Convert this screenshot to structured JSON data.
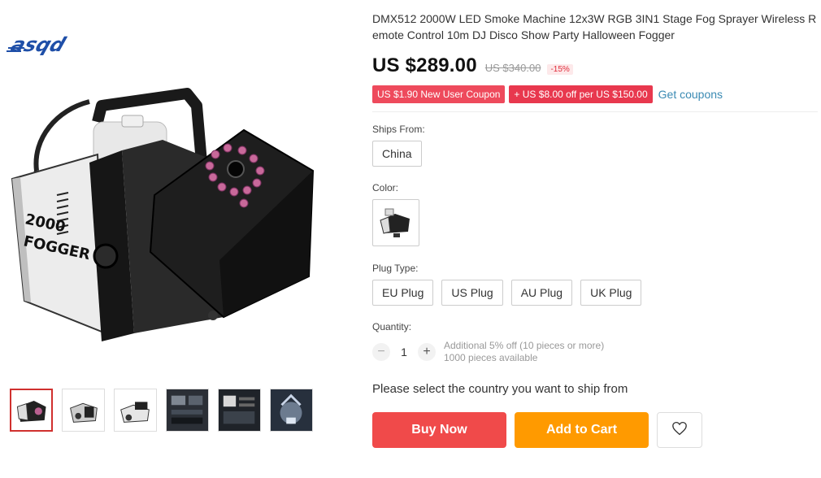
{
  "brand": {
    "logo_text": "asqd"
  },
  "product": {
    "title": "DMX512 2000W LED Smoke Machine 12x3W RGB 3IN1 Stage Fog Sprayer Wireless Remote Control 10m DJ Disco Show Party Halloween Fogger",
    "image_label": "2000 FOGGER"
  },
  "price": {
    "current": "US $289.00",
    "original": "US $340.00",
    "discount": "-15%"
  },
  "coupons": {
    "items": [
      "US $1.90 New User Coupon",
      "+ US $8.00 off per US $150.00"
    ],
    "get_link": "Get coupons"
  },
  "ships_from": {
    "label": "Ships From:",
    "options": [
      "China"
    ]
  },
  "color": {
    "label": "Color:"
  },
  "plug_type": {
    "label": "Plug Type:",
    "options": [
      "EU Plug",
      "US Plug",
      "AU Plug",
      "UK Plug"
    ]
  },
  "quantity": {
    "label": "Quantity:",
    "minus": "−",
    "value": "1",
    "plus": "+",
    "note_discount": "Additional 5% off (10 pieces or more)",
    "note_available": "1000 pieces available"
  },
  "ship_note": "Please select the country you want to ship from",
  "actions": {
    "buy_now": "Buy Now",
    "add_to_cart": "Add to Cart"
  },
  "icons": {
    "wishlist": "heart-icon"
  },
  "colors": {
    "accent_red": "#f04a4a",
    "cart_orange": "#ff9a00",
    "coupon_red": "#e8384e",
    "link_blue": "#3a8ab3"
  }
}
